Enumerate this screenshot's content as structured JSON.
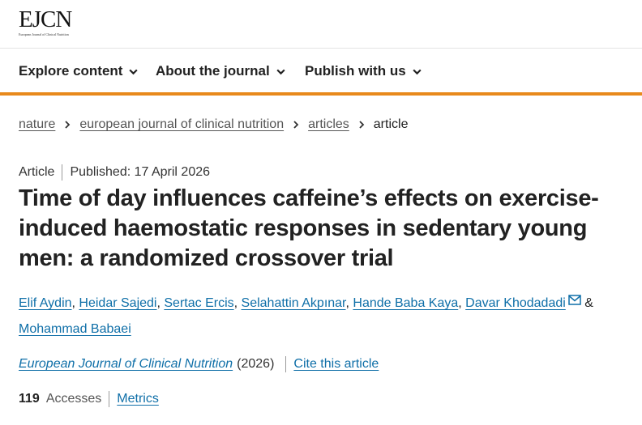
{
  "header": {
    "logo_text": "EJCN",
    "logo_subtitle": "European Journal of Clinical Nutrition"
  },
  "nav": {
    "items": [
      {
        "label": "Explore content"
      },
      {
        "label": "About the journal"
      },
      {
        "label": "Publish with us"
      }
    ]
  },
  "breadcrumb": {
    "items": [
      {
        "label": "nature"
      },
      {
        "label": "european journal of clinical nutrition"
      },
      {
        "label": "articles"
      }
    ],
    "current": "article"
  },
  "article": {
    "type": "Article",
    "published": "Published: 17 April 2026",
    "title": "Time of day influences caffeine’s effects on exercise-induced haemostatic responses in sedentary young men: a randomized crossover trial",
    "authors": [
      "Elif Aydin",
      "Heidar Sajedi",
      "Sertac Ercis",
      "Selahattin Akpınar",
      "Hande Baba Kaya",
      "Davar Khodadadi",
      "Mohammad Babaei"
    ],
    "author_separator": ", ",
    "author_last_joiner": "&",
    "journal_name": "European Journal of Clinical Nutrition",
    "year": "(2026)",
    "cite_label": "Cite this article",
    "accesses_count": "119",
    "accesses_label": "Accesses",
    "metrics_label": "Metrics"
  },
  "icons": {
    "nav_chevron": "chevron-down-icon",
    "breadcrumb_separator": "chevron-right-icon",
    "corresponding_author": "envelope-icon"
  },
  "colors": {
    "accent_orange": "#e8891c",
    "link_blue": "#0f6fa8"
  }
}
